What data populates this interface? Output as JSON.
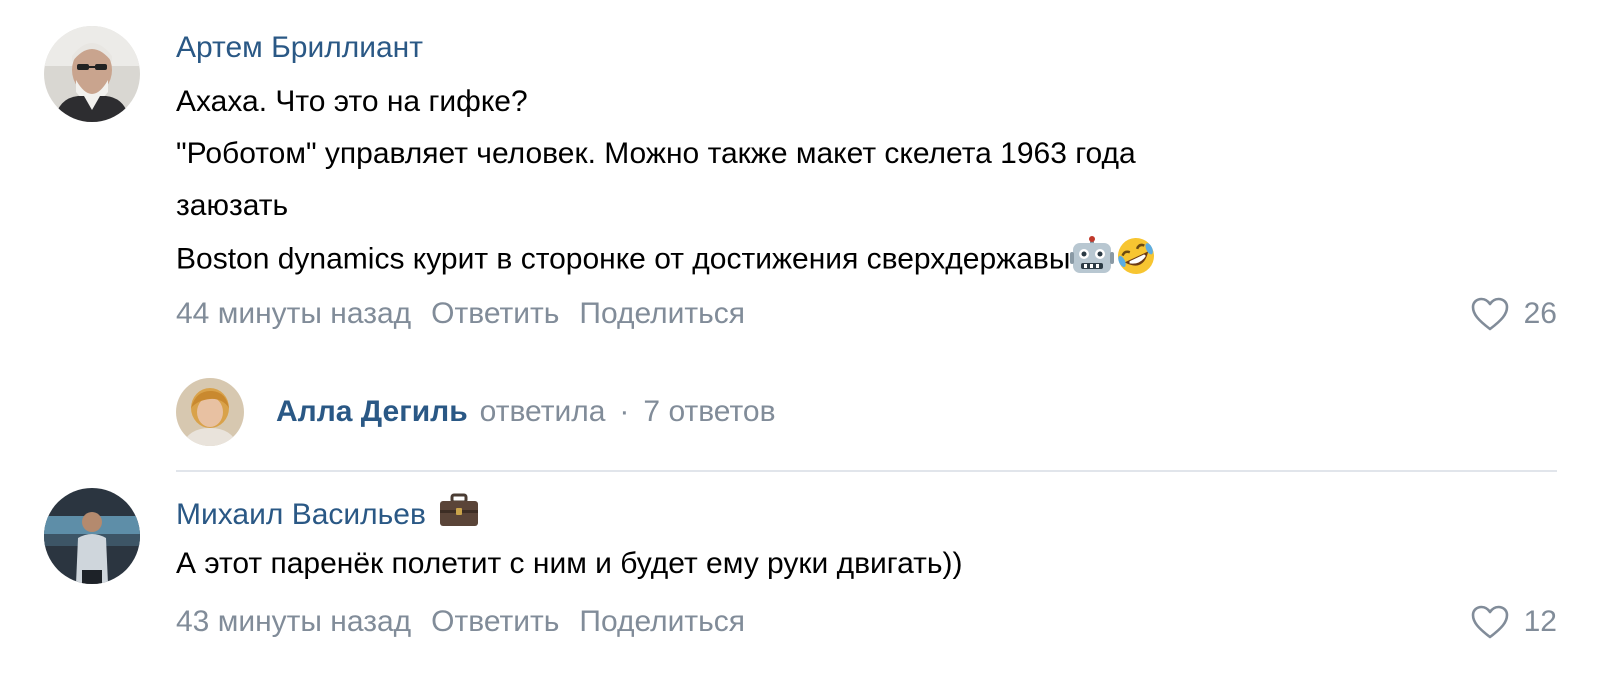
{
  "comments": [
    {
      "author": "Артем Бриллиант",
      "lines": [
        "Ахаха. Что это на гифке?",
        "\"Роботом\" управляет человек. Можно также макет скелета 1963 года",
        "заюзать",
        "Boston dynamics курит в сторонке от достижения сверхдержавы"
      ],
      "emojis": [
        "robot-face",
        "rolling-on-floor-laughing"
      ],
      "time": "44 минуты назад",
      "reply_label": "Ответить",
      "share_label": "Поделиться",
      "likes": "26",
      "replies": {
        "name": "Алла Дегиль",
        "verb": "ответила",
        "separator": "·",
        "count": "7 ответов"
      }
    },
    {
      "author": "Михаил Васильев",
      "author_badge": "briefcase",
      "lines": [
        "А этот паренёк полетит с ним и будет ему руки двигать))"
      ],
      "time": "43 минуты назад",
      "reply_label": "Ответить",
      "share_label": "Поделиться",
      "likes": "12"
    }
  ],
  "colors": {
    "author": "#2a5885",
    "secondary": "#818c99",
    "text": "#000000",
    "divider": "#e1e5eb"
  }
}
